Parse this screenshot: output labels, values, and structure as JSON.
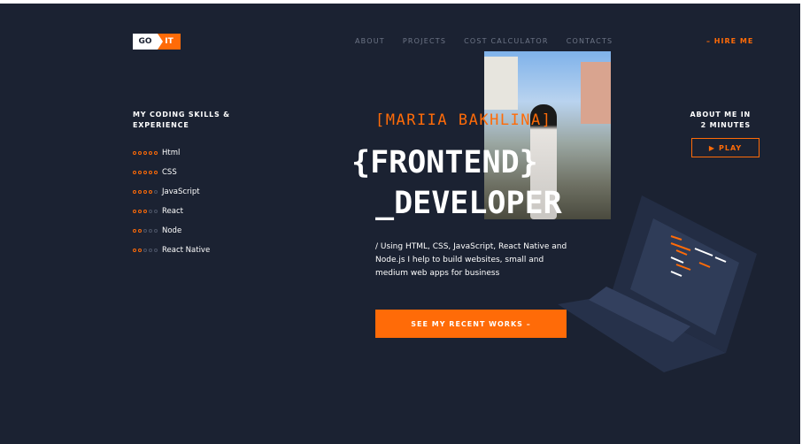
{
  "logo": {
    "left": "GO",
    "right": "IT"
  },
  "nav": {
    "items": [
      "ABOUT",
      "PROJECTS",
      "COST CALCULATOR",
      "CONTACTS"
    ],
    "hire": "– HIRE ME"
  },
  "skills": {
    "title": "MY CODING SKILLS & EXPERIENCE",
    "items": [
      {
        "label": "Html",
        "level": 5
      },
      {
        "label": "CSS",
        "level": 5
      },
      {
        "label": "JavaScript",
        "level": 4
      },
      {
        "label": "React",
        "level": 3
      },
      {
        "label": "Node",
        "level": 2
      },
      {
        "label": "React Native",
        "level": 2
      }
    ]
  },
  "hero": {
    "name": "[MARIIA BAKHLINA]",
    "title_line1": "{FRONTEND}",
    "title_line2": "_DEVELOPER",
    "description": "/ Using HTML, CSS, JavaScript, React Native and Node.js I help to build websites, small and medium web apps for business",
    "cta": "SEE MY RECENT WORKS –"
  },
  "about": {
    "title": "ABOUT ME IN 2 MINUTES",
    "play": "PLAY",
    "play_icon": "play-icon"
  },
  "colors": {
    "background": "#1b2232",
    "accent": "#ff6b08",
    "text": "#ffffff",
    "nav": "#6e7687"
  }
}
